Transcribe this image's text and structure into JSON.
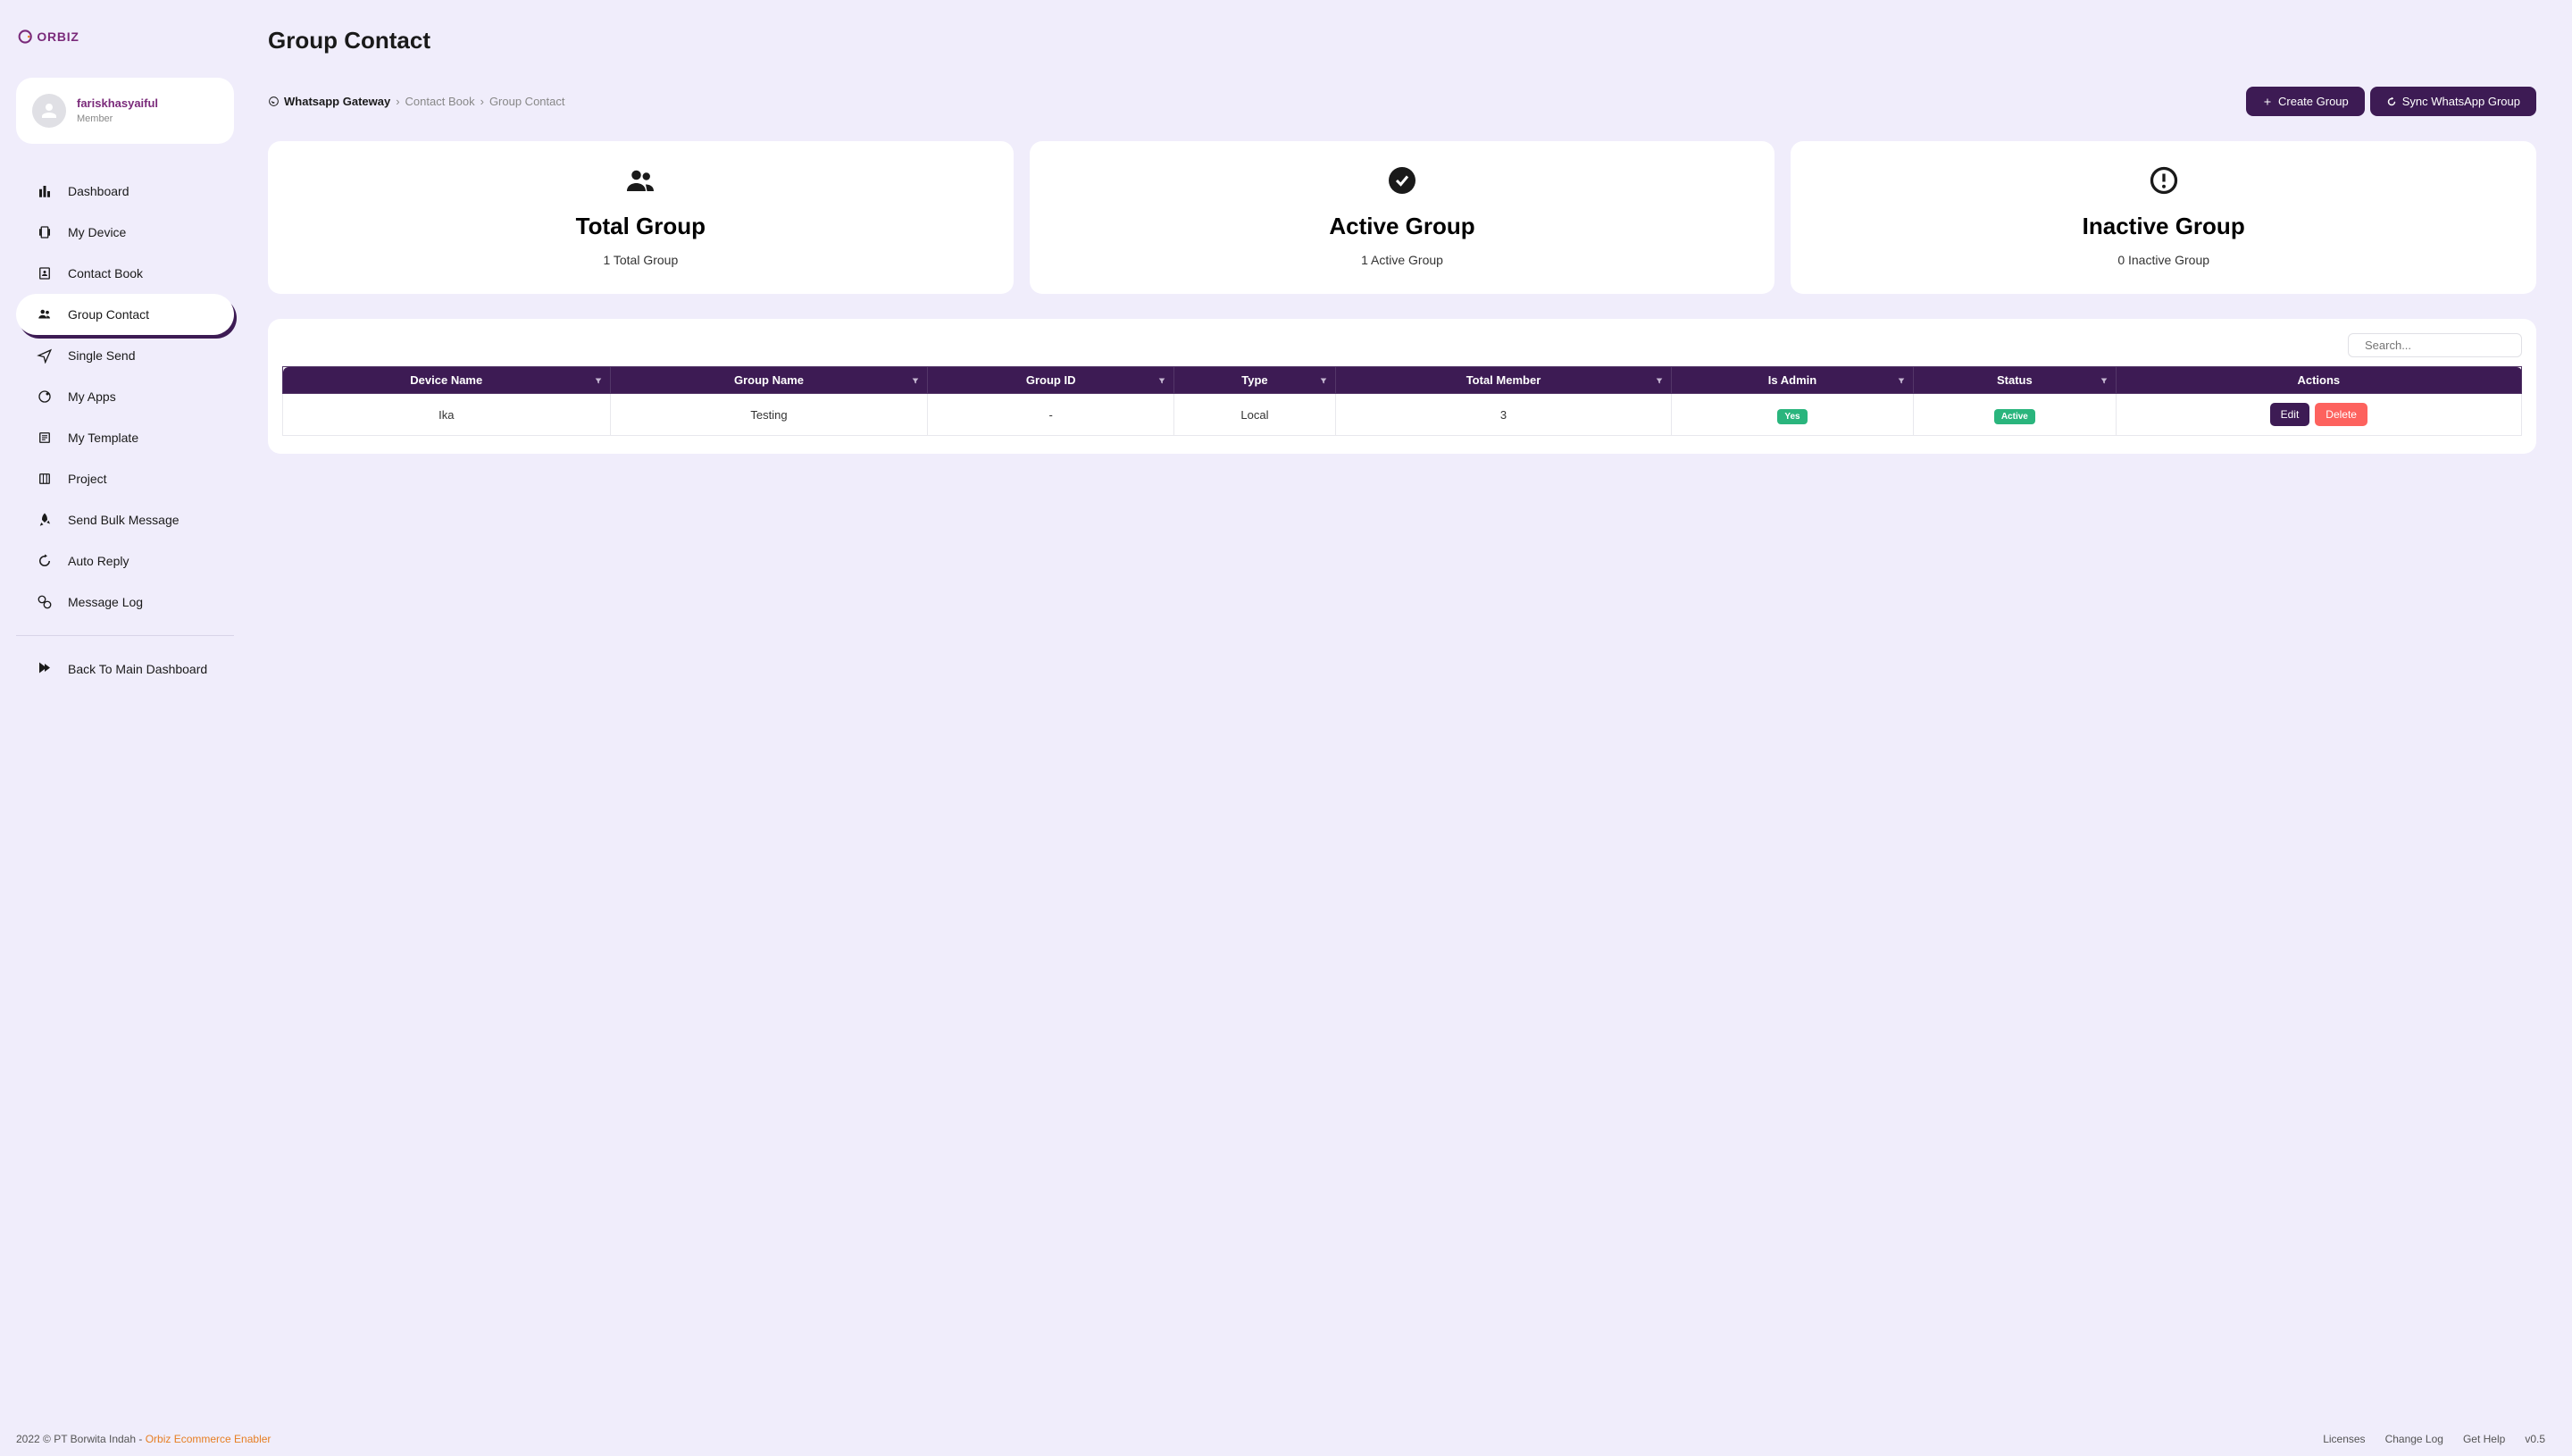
{
  "logo_text": "ORBIZ",
  "profile": {
    "name": "fariskhasyaiful",
    "role": "Member"
  },
  "nav": {
    "items": [
      {
        "label": "Dashboard"
      },
      {
        "label": "My Device"
      },
      {
        "label": "Contact Book"
      },
      {
        "label": "Group Contact"
      },
      {
        "label": "Single Send"
      },
      {
        "label": "My Apps"
      },
      {
        "label": "My Template"
      },
      {
        "label": "Project"
      },
      {
        "label": "Send Bulk Message"
      },
      {
        "label": "Auto Reply"
      },
      {
        "label": "Message Log"
      }
    ],
    "back": "Back To Main Dashboard"
  },
  "page_title": "Group Contact",
  "breadcrumb": {
    "root": "Whatsapp Gateway",
    "mid": "Contact Book",
    "current": "Group Contact"
  },
  "buttons": {
    "create": "Create Group",
    "sync": "Sync WhatsApp Group"
  },
  "stats": {
    "total": {
      "title": "Total Group",
      "sub": "1 Total Group"
    },
    "active": {
      "title": "Active Group",
      "sub": "1 Active Group"
    },
    "inactive": {
      "title": "Inactive Group",
      "sub": "0 Inactive Group"
    }
  },
  "search": {
    "placeholder": "Search..."
  },
  "table": {
    "headers": {
      "device_name": "Device Name",
      "group_name": "Group Name",
      "group_id": "Group ID",
      "type": "Type",
      "total_member": "Total Member",
      "is_admin": "Is Admin",
      "status": "Status",
      "actions": "Actions"
    },
    "rows": [
      {
        "device_name": "Ika",
        "group_name": "Testing",
        "group_id": "-",
        "type": "Local",
        "total_member": "3",
        "is_admin": "Yes",
        "status": "Active",
        "edit": "Edit",
        "delete": "Delete"
      }
    ]
  },
  "footer": {
    "copyright": "2022 © PT Borwita Indah - ",
    "brand": "Orbiz Ecommerce Enabler",
    "licenses": "Licenses",
    "changelog": "Change Log",
    "help": "Get Help",
    "version": "v0.5"
  }
}
